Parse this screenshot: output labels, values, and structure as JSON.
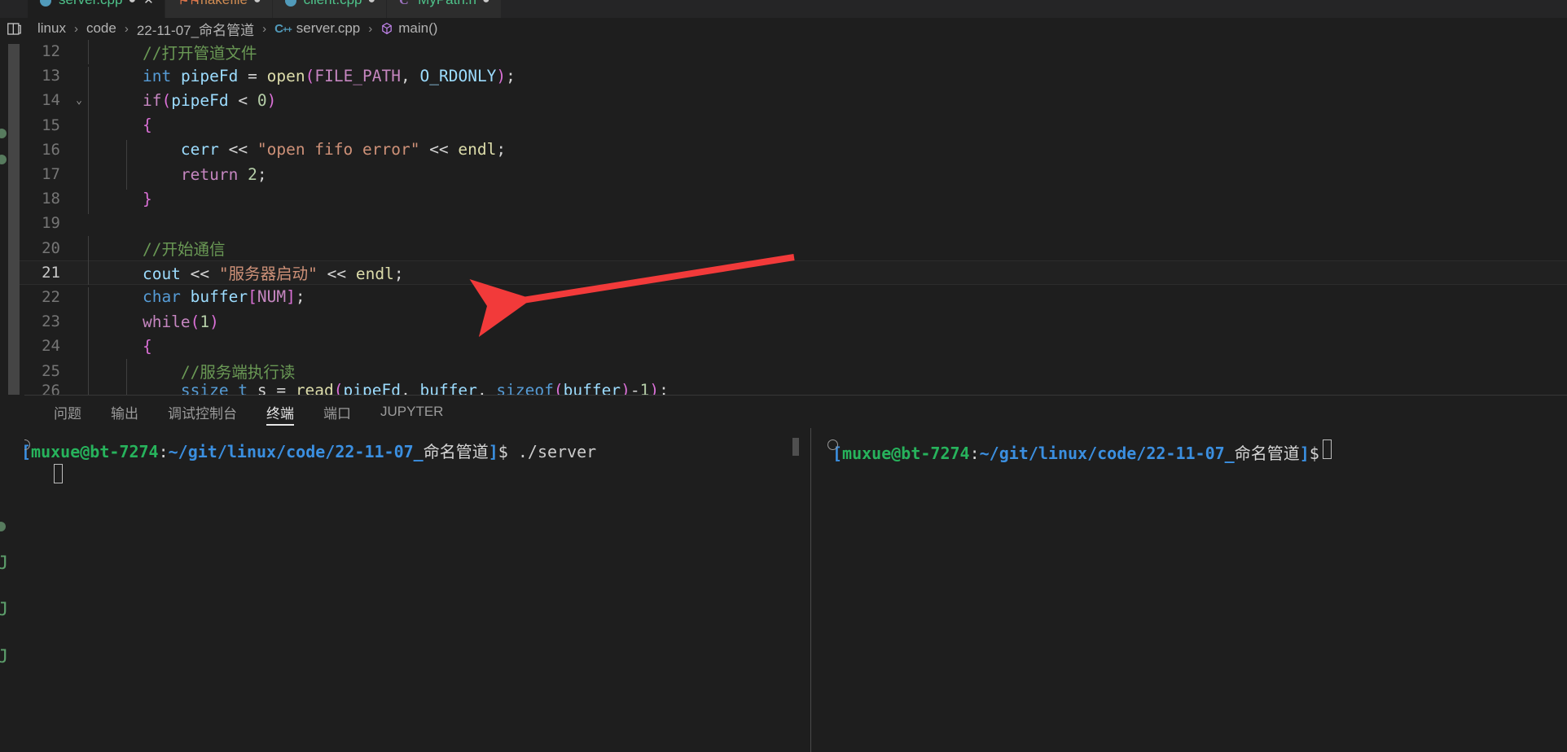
{
  "window": {
    "theme_bg": "#1e1e1e",
    "accent": "#519aba"
  },
  "tabs": [
    {
      "label": "server.cpp",
      "icon": "cpp-file-icon",
      "dirty": "●",
      "close": "✕",
      "active": true
    },
    {
      "label": "makefile",
      "icon": "makefile-icon",
      "dirty": "●",
      "close": "",
      "active": false
    },
    {
      "label": "client.cpp",
      "icon": "cpp-file-icon",
      "dirty": "●",
      "close": "",
      "active": false
    },
    {
      "label": "MyPath.h",
      "icon": "header-file-icon",
      "dirty": "●",
      "close": "",
      "active": false
    }
  ],
  "breadcrumb": {
    "split_icon": "split-editor-icon",
    "items": [
      {
        "label": "linux",
        "icon": ""
      },
      {
        "label": "code",
        "icon": ""
      },
      {
        "label": "22-11-07_命名管道",
        "icon": ""
      },
      {
        "label": "server.cpp",
        "icon": "cpp-file-icon"
      },
      {
        "label": "main()",
        "icon": "symbol-method-icon"
      }
    ],
    "separator": "›"
  },
  "editor": {
    "language": "cpp",
    "current_line": 21,
    "lines": [
      {
        "num": "12",
        "fold": "",
        "indent": 1,
        "tokens": [
          {
            "t": "//打开管道文件",
            "c": "t-com",
            "pre": "    "
          }
        ]
      },
      {
        "num": "13",
        "fold": "",
        "indent": 1,
        "tokens": [
          {
            "t": "int",
            "c": "t-kw",
            "pre": "    "
          },
          {
            "t": " ",
            "c": "t-plain"
          },
          {
            "t": "pipeFd",
            "c": "t-var"
          },
          {
            "t": " = ",
            "c": "t-op"
          },
          {
            "t": "open",
            "c": "t-fn"
          },
          {
            "t": "(",
            "c": "t-pnk"
          },
          {
            "t": "FILE_PATH",
            "c": "t-macro"
          },
          {
            "t": ", ",
            "c": "t-op"
          },
          {
            "t": "O_RDONLY",
            "c": "t-var"
          },
          {
            "t": ")",
            "c": "t-pnk"
          },
          {
            "t": ";",
            "c": "t-op"
          }
        ]
      },
      {
        "num": "14",
        "fold": "⌄",
        "indent": 1,
        "tokens": [
          {
            "t": "if",
            "c": "t-kwp",
            "pre": "    "
          },
          {
            "t": "(",
            "c": "t-pnk"
          },
          {
            "t": "pipeFd",
            "c": "t-var"
          },
          {
            "t": " < ",
            "c": "t-op"
          },
          {
            "t": "0",
            "c": "t-num"
          },
          {
            "t": ")",
            "c": "t-pnk"
          }
        ]
      },
      {
        "num": "15",
        "fold": "",
        "indent": 1,
        "tokens": [
          {
            "t": "{",
            "c": "t-pnk",
            "pre": "    "
          }
        ]
      },
      {
        "num": "16",
        "fold": "",
        "indent": 2,
        "tokens": [
          {
            "t": "cerr",
            "c": "t-var",
            "pre": "        "
          },
          {
            "t": " << ",
            "c": "t-op"
          },
          {
            "t": "\"open fifo error\"",
            "c": "t-str"
          },
          {
            "t": " << ",
            "c": "t-op"
          },
          {
            "t": "endl",
            "c": "t-fn"
          },
          {
            "t": ";",
            "c": "t-op"
          }
        ]
      },
      {
        "num": "17",
        "fold": "",
        "indent": 2,
        "tokens": [
          {
            "t": "return",
            "c": "t-kwp",
            "pre": "        "
          },
          {
            "t": " ",
            "c": "t-plain"
          },
          {
            "t": "2",
            "c": "t-num"
          },
          {
            "t": ";",
            "c": "t-op"
          }
        ]
      },
      {
        "num": "18",
        "fold": "",
        "indent": 1,
        "tokens": [
          {
            "t": "}",
            "c": "t-pnk",
            "pre": "    "
          }
        ]
      },
      {
        "num": "19",
        "fold": "",
        "indent": 0,
        "tokens": []
      },
      {
        "num": "20",
        "fold": "",
        "indent": 1,
        "tokens": [
          {
            "t": "//开始通信",
            "c": "t-com",
            "pre": "    "
          }
        ]
      },
      {
        "num": "21",
        "fold": "",
        "indent": 1,
        "current": true,
        "tokens": [
          {
            "t": "cout",
            "c": "t-var",
            "pre": "    "
          },
          {
            "t": " << ",
            "c": "t-op"
          },
          {
            "t": "\"服务器启动\"",
            "c": "t-str"
          },
          {
            "t": " << ",
            "c": "t-op"
          },
          {
            "t": "endl",
            "c": "t-fn"
          },
          {
            "t": ";",
            "c": "t-op"
          }
        ]
      },
      {
        "num": "22",
        "fold": "",
        "indent": 1,
        "tokens": [
          {
            "t": "char",
            "c": "t-kw",
            "pre": "    "
          },
          {
            "t": " ",
            "c": "t-plain"
          },
          {
            "t": "buffer",
            "c": "t-var"
          },
          {
            "t": "[",
            "c": "t-pnk"
          },
          {
            "t": "NUM",
            "c": "t-macro"
          },
          {
            "t": "]",
            "c": "t-pnk"
          },
          {
            "t": ";",
            "c": "t-op"
          }
        ]
      },
      {
        "num": "23",
        "fold": "",
        "indent": 1,
        "tokens": [
          {
            "t": "while",
            "c": "t-kwp",
            "pre": "    "
          },
          {
            "t": "(",
            "c": "t-pnk"
          },
          {
            "t": "1",
            "c": "t-num"
          },
          {
            "t": ")",
            "c": "t-pnk"
          }
        ]
      },
      {
        "num": "24",
        "fold": "",
        "indent": 1,
        "tokens": [
          {
            "t": "{",
            "c": "t-pnk",
            "pre": "    "
          }
        ]
      },
      {
        "num": "25",
        "fold": "",
        "indent": 2,
        "tokens": [
          {
            "t": "//服务端执行读",
            "c": "t-com",
            "pre": "        "
          }
        ]
      },
      {
        "num": "26",
        "fold": "",
        "indent": 2,
        "clipped": true,
        "tokens": [
          {
            "t": "ssize_t",
            "c": "t-kw",
            "pre": "        "
          },
          {
            "t": " s = ",
            "c": "t-op"
          },
          {
            "t": "read",
            "c": "t-fn"
          },
          {
            "t": "(",
            "c": "t-pnk"
          },
          {
            "t": "pipeFd",
            "c": "t-var"
          },
          {
            "t": ", ",
            "c": "t-op"
          },
          {
            "t": "buffer",
            "c": "t-var"
          },
          {
            "t": ", ",
            "c": "t-op"
          },
          {
            "t": "sizeof",
            "c": "t-kw"
          },
          {
            "t": "(",
            "c": "t-pnk"
          },
          {
            "t": "buffer",
            "c": "t-var"
          },
          {
            "t": ")",
            "c": "t-pnk"
          },
          {
            "t": "-",
            "c": "t-op"
          },
          {
            "t": "1",
            "c": "t-num"
          },
          {
            "t": ")",
            "c": "t-pnk"
          },
          {
            "t": ";",
            "c": "t-op"
          }
        ]
      }
    ]
  },
  "annotation": {
    "type": "arrow",
    "color": "#f23a3a",
    "points_to": "line 21 cout << \"服务器启动\" << endl;"
  },
  "panel": {
    "tabs": [
      {
        "label": "问题",
        "active": false
      },
      {
        "label": "输出",
        "active": false
      },
      {
        "label": "调试控制台",
        "active": false
      },
      {
        "label": "终端",
        "active": true
      },
      {
        "label": "端口",
        "active": false
      },
      {
        "label": "JUPYTER",
        "active": false
      }
    ],
    "terminals": [
      {
        "name": "terminal-left",
        "lines": [
          {
            "bullet": true,
            "parts": [
              {
                "text": "[",
                "c": "p-brk"
              },
              {
                "text": "muxue@bt-7274",
                "c": "p-user"
              },
              {
                "text": ":",
                "c": "p-cn"
              },
              {
                "text": "~/git/linux/code/22-11-07_",
                "c": "p-path"
              },
              {
                "text": "命名管道",
                "c": "p-cn"
              },
              {
                "text": "]",
                "c": "p-brk"
              },
              {
                "text": "$ ",
                "c": "p-dollar"
              },
              {
                "text": "./server",
                "c": "p-cmd"
              }
            ]
          },
          {
            "bullet": false,
            "indent": true,
            "parts": [],
            "cursor": true
          }
        ]
      },
      {
        "name": "terminal-right",
        "lines": [
          {
            "bullet": true,
            "parts": [
              {
                "text": "[",
                "c": "p-brk"
              },
              {
                "text": "muxue@bt-7274",
                "c": "p-user"
              },
              {
                "text": ":",
                "c": "p-cn"
              },
              {
                "text": "~/git/linux/code/22-11-07_",
                "c": "p-path"
              },
              {
                "text": "命名管道",
                "c": "p-cn"
              },
              {
                "text": "]",
                "c": "p-brk"
              },
              {
                "text": "$",
                "c": "p-dollar"
              }
            ],
            "cursor": true
          }
        ]
      }
    ]
  }
}
